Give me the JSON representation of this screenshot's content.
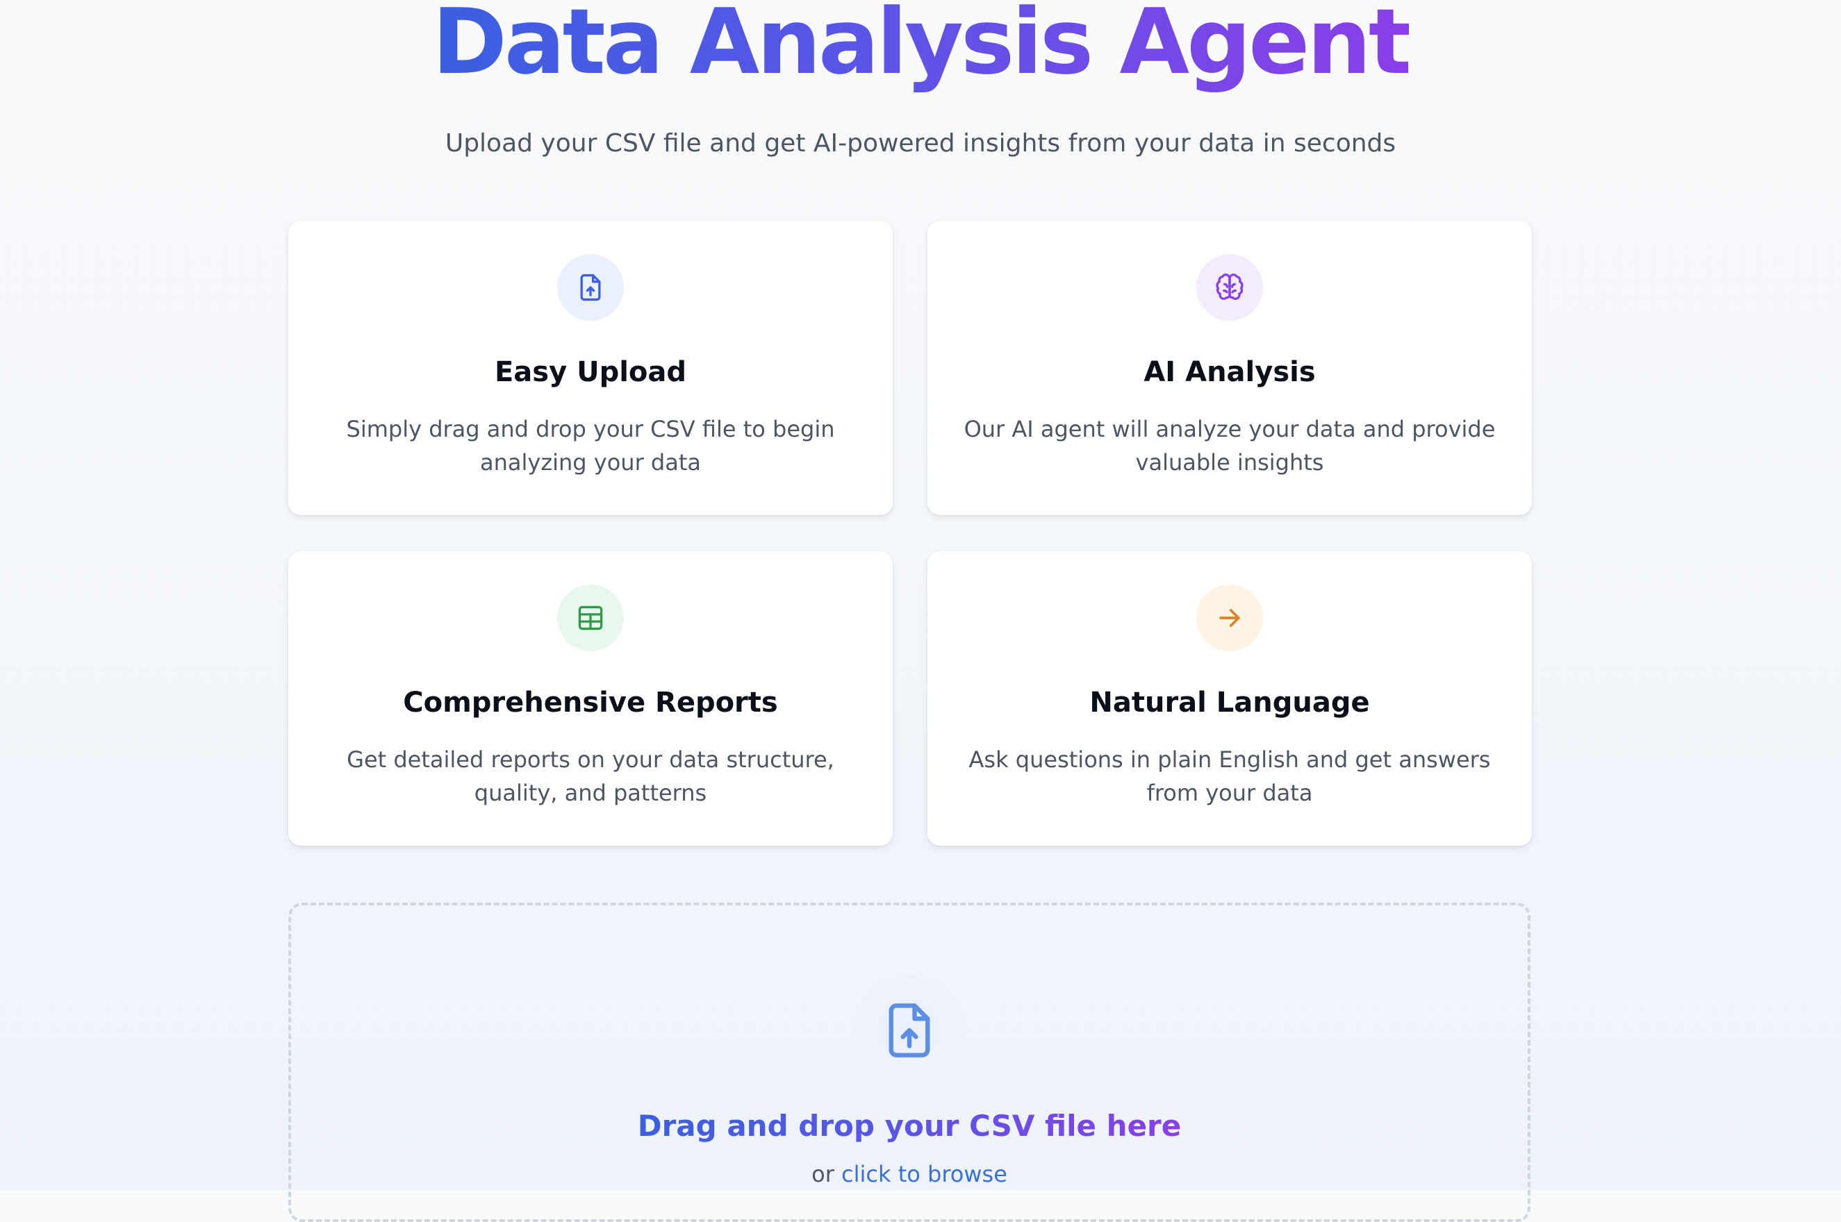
{
  "header": {
    "title": "Data Analysis Agent",
    "subtitle": "Upload your CSV file and get AI-powered insights from your data in seconds"
  },
  "features": [
    {
      "icon": "file-upload-icon",
      "title": "Easy Upload",
      "description": "Simply drag and drop your CSV file to begin analyzing your data",
      "icon_color": "#3b5fe0",
      "icon_bg": "#eaf0fd"
    },
    {
      "icon": "brain-icon",
      "title": "AI Analysis",
      "description": "Our AI agent will analyze your data and provide valuable insights",
      "icon_color": "#8a3ee8",
      "icon_bg": "#f3ecfd"
    },
    {
      "icon": "table-icon",
      "title": "Comprehensive Reports",
      "description": "Get detailed reports on your data structure, quality, and patterns",
      "icon_color": "#2f9a4a",
      "icon_bg": "#e9f8ee"
    },
    {
      "icon": "arrow-right-icon",
      "title": "Natural Language",
      "description": "Ask questions in plain English and get answers from your data",
      "icon_color": "#d9822b",
      "icon_bg": "#fdf4e3"
    }
  ],
  "dropzone": {
    "icon": "file-upload-icon",
    "title": "Drag and drop your CSV file here",
    "or_text": "or",
    "browse_link": "click to browse",
    "icon_color": "#5b8fe6"
  },
  "colors": {
    "gradient_start": "#3b5fe0",
    "gradient_end": "#8a3ee8",
    "link": "#3b6fd8"
  }
}
